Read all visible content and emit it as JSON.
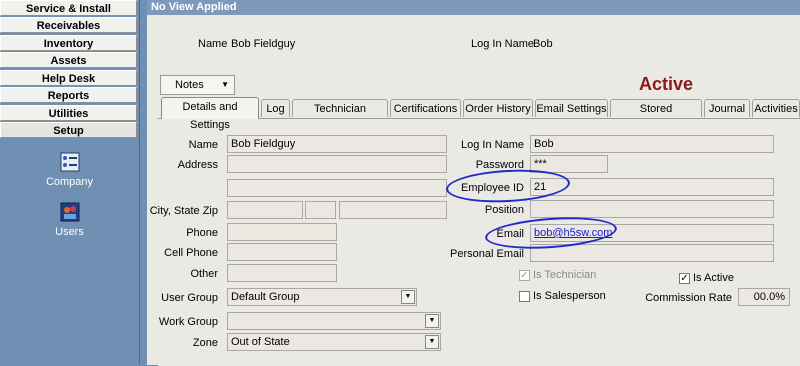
{
  "sidebar": {
    "items": [
      {
        "label": "Service & Install"
      },
      {
        "label": "Receivables"
      },
      {
        "label": "Inventory"
      },
      {
        "label": "Assets"
      },
      {
        "label": "Help Desk"
      },
      {
        "label": "Reports"
      },
      {
        "label": "Utilities"
      },
      {
        "label": "Setup"
      }
    ],
    "tools": [
      {
        "label": "Company",
        "icon": "company-icon"
      },
      {
        "label": "Users",
        "icon": "users-icon"
      }
    ]
  },
  "header": {
    "view_title": "No View Applied"
  },
  "summary": {
    "name_label": "Name",
    "name_value": "Bob Fieldguy",
    "login_label": "Log In Name",
    "login_value": "Bob"
  },
  "notes_button": "Notes",
  "status": "Active",
  "tabs": [
    {
      "label": "Details and Settings"
    },
    {
      "label": "Log"
    },
    {
      "label": "Technician Settings"
    },
    {
      "label": "Certifications"
    },
    {
      "label": "Order History"
    },
    {
      "label": "Email Settings"
    },
    {
      "label": "Stored Documents"
    },
    {
      "label": "Journal"
    },
    {
      "label": "Activities"
    }
  ],
  "form": {
    "name_label": "Name",
    "name_value": "Bob Fieldguy",
    "address_label": "Address",
    "address1": "",
    "address2": "",
    "csz_label": "City, State Zip",
    "city": "",
    "state": "",
    "zip": "",
    "phone_label": "Phone",
    "phone": "",
    "cell_label": "Cell Phone",
    "cell": "",
    "other_label": "Other",
    "other": "",
    "user_group_label": "User Group",
    "user_group": "Default Group",
    "work_group_label": "Work Group",
    "work_group": "",
    "zone_label": "Zone",
    "zone": "Out of State",
    "login_label": "Log In Name",
    "login_value": "Bob",
    "password_label": "Password",
    "password_value": "***",
    "employee_id_label": "Employee ID",
    "employee_id": "21",
    "position_label": "Position",
    "position": "",
    "email_label": "Email",
    "email": "bob@h5sw.com",
    "personal_email_label": "Personal Email",
    "personal_email": "",
    "is_technician_label": "Is Technician",
    "is_technician": true,
    "is_salesperson_label": "Is Salesperson",
    "is_salesperson": false,
    "is_active_label": "Is Active",
    "is_active": true,
    "commission_label": "Commission Rate",
    "commission_value": "00.0%"
  },
  "colors": {
    "status": "#8b1a1a",
    "annotation": "#1f2bc9",
    "sidebar": "#6f8fb3"
  }
}
